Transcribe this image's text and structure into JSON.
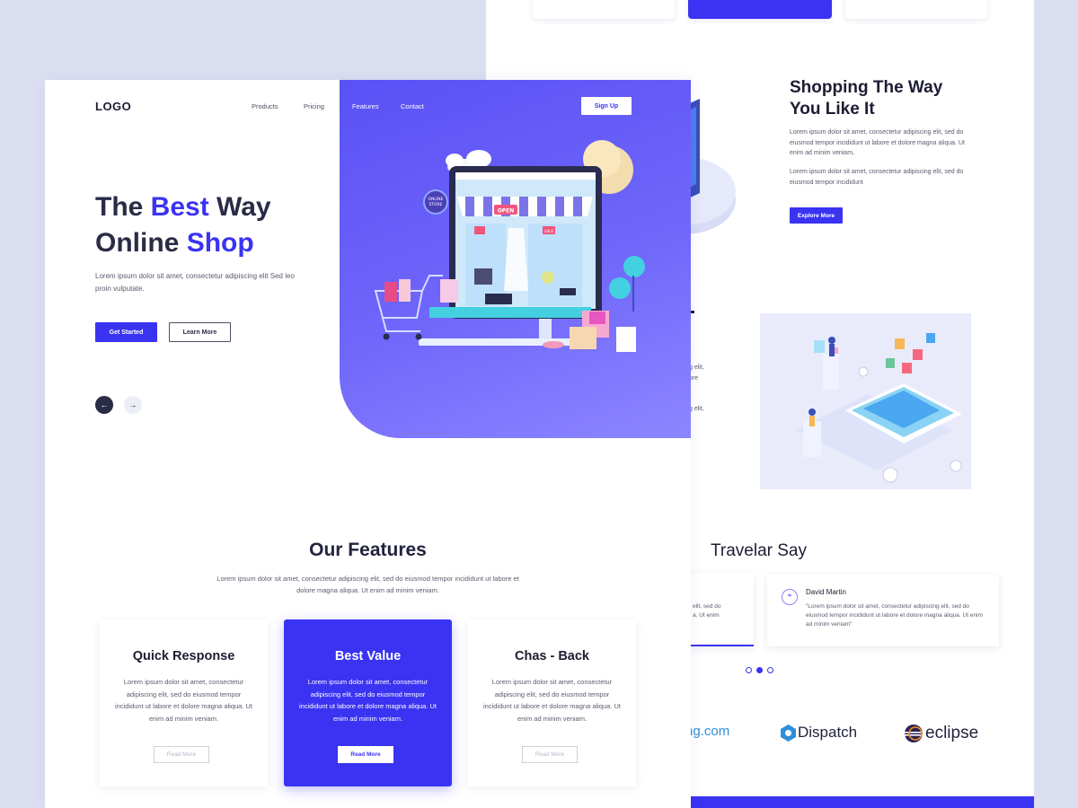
{
  "front": {
    "logo": "LOGO",
    "nav": [
      "Products",
      "Pricing",
      "Features",
      "Contact"
    ],
    "signup_label": "Sign Up",
    "hero": {
      "title_1": "The ",
      "title_accent_1": "Best",
      "title_2": " Way",
      "title_3": "Online ",
      "title_accent_2": "Shop",
      "subtitle": "Lorem ipsum dolor sit amet, consectetur adipiscing elit Sed leo proin vulputate.",
      "primary_label": "Get Started",
      "secondary_label": "Learn More",
      "prev_icon": "arrow-left-icon",
      "next_icon": "arrow-right-icon",
      "illustration": {
        "open_sign": "OPEN",
        "sale_tag": "SALE",
        "store_badge": "ONLINE STORE"
      }
    },
    "features": {
      "title": "Our Features",
      "subtitle": "Lorem ipsum dolor sit amet, consectetur adipiscing elit, sed do eiusmod tempor incididunt ut labore et dolore magna aliqua. Ut enim ad minim veniam.",
      "cards": [
        {
          "title": "Quick Response",
          "text": "Lorem ipsum dolor sit amet, consectetur adipiscing elit, sed do eiusmod tempor incididunt ut labore et dolore magna aliqua. Ut enim ad minim veniam.",
          "button": "Read More"
        },
        {
          "title": "Best Value",
          "text": "Lorem ipsum dolor sit amet, consectetur adipiscing elit, sed do eiusmod tempor incididunt ut labore et dolore magna aliqua. Ut enim ad minim veniam.",
          "button": "Read More"
        },
        {
          "title": "Chas - Back",
          "text": "Lorem ipsum dolor sit amet, consectetur adipiscing elit, sed do eiusmod tempor incididunt ut labore et dolore magna aliqua. Ut enim ad minim veniam.",
          "button": "Read More"
        }
      ]
    }
  },
  "back": {
    "shop_title_1": "Shopping The Way",
    "shop_title_2": "You Like It",
    "shop_p1": "Lorem ipsum dolor sit amet, consectetur adipiscing elit, sed do eiusmod tempor incididunt ut labore et dolore magna aliqua. Ut enim ad minim veniam,",
    "shop_p2": "Lorem ipsum dolor sit amet, consectetur adipiscing elit, sed do eiusmod tempor incididunt",
    "explore_label": "Explore More",
    "fragments": [
      "g elit,",
      "ore",
      "g elit,"
    ],
    "travel_title": "Travelar Say",
    "testimonial_left": [
      "elit, sed do",
      "a. Ut enim"
    ],
    "testimonial": {
      "quote_icon": "quote-icon",
      "name": "David Martin",
      "text": "\"Lorem ipsum dolor sit amet, consectetur adipiscing elit, sed do eiusmod tempor incididunt ut labore et dolore magna aliqua. Ut enim ad minim veniam\""
    },
    "partners": {
      "booking_partial": "ng.com",
      "dispatch": "Dispatch",
      "eclipse": "eclipse"
    },
    "colors": {
      "accent": "#3a33f2",
      "dark": "#1c1d33"
    }
  }
}
